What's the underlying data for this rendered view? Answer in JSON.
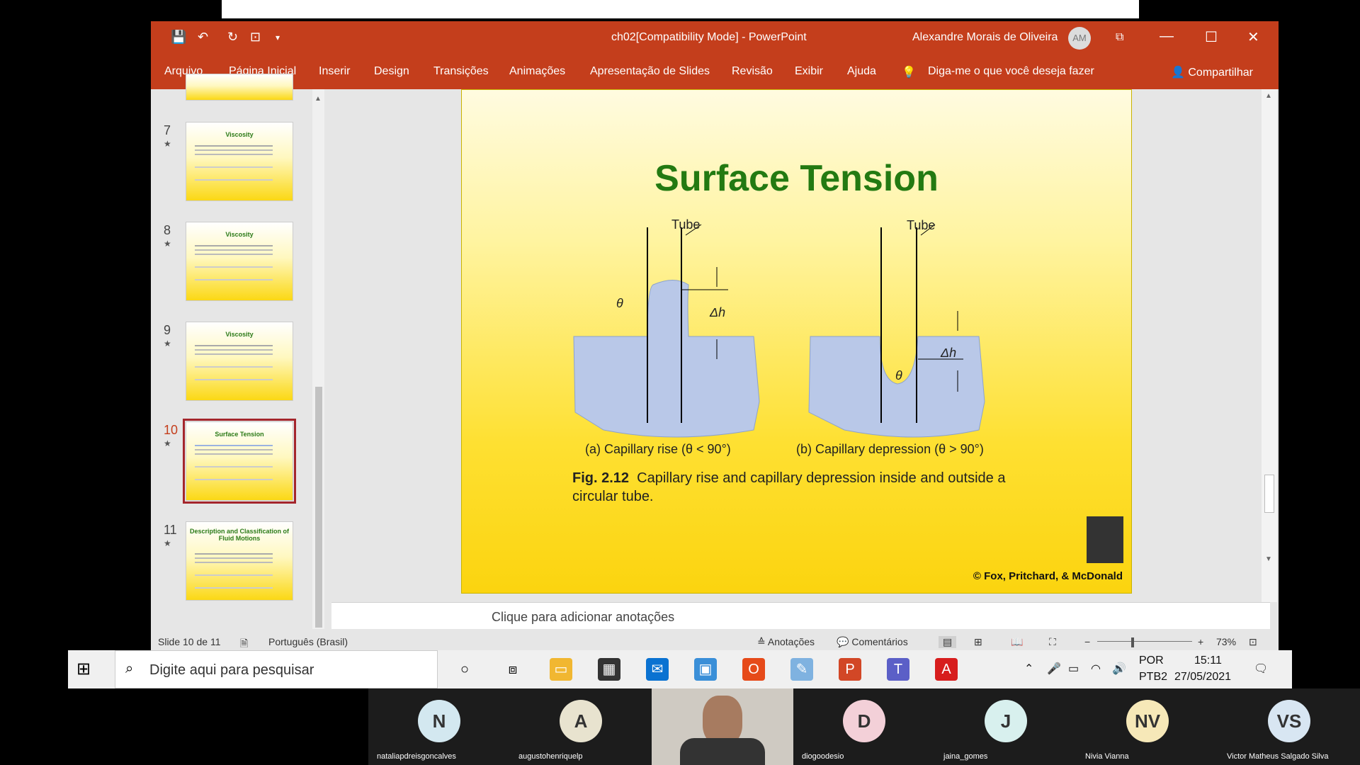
{
  "window": {
    "title": "ch02[Compatibility Mode]  -  PowerPoint",
    "user": "Alexandre Morais de Oliveira",
    "avatar": "AM"
  },
  "ribbon": {
    "tabs": [
      "Arquivo",
      "Página Inicial",
      "Inserir",
      "Design",
      "Transições",
      "Animações",
      "Apresentação de Slides",
      "Revisão",
      "Exibir",
      "Ajuda"
    ],
    "tell_me": "Diga-me o que você deseja fazer",
    "share": "Compartilhar"
  },
  "slides": [
    {
      "number": "7",
      "title": "Viscosity"
    },
    {
      "number": "8",
      "title": "Viscosity"
    },
    {
      "number": "9",
      "title": "Viscosity"
    },
    {
      "number": "10",
      "title": "Surface Tension"
    },
    {
      "number": "11",
      "title": "Description and Classification of Fluid Motions"
    }
  ],
  "slide": {
    "title": "Surface Tension",
    "tube_label": "Tube",
    "theta": "θ",
    "delta_h": "Δh",
    "caption_a": "(a) Capillary rise (θ < 90°)",
    "caption_b": "(b) Capillary depression (θ > 90°)",
    "fig_label": "Fig. 2.12",
    "fig_text": "Capillary rise and capillary depression inside and outside a circular tube.",
    "copyright": "© Fox, Pritchard, & McDonald"
  },
  "notes_placeholder": "Clique para adicionar anotações",
  "status": {
    "slide": "Slide 10 de 11",
    "language": "Português (Brasil)",
    "notes": "Anotações",
    "comments": "Comentários",
    "zoom": "73%"
  },
  "taskbar": {
    "search": "Digite aqui para pesquisar",
    "lang": "POR",
    "layout": "PTB2",
    "time": "15:11",
    "date": "27/05/2021"
  },
  "meeting": [
    {
      "initials": "N",
      "name": "nataliapdreisgoncalves"
    },
    {
      "initials": "A",
      "name": "augustohenriquelp"
    },
    {
      "initials": "",
      "name": ""
    },
    {
      "initials": "D",
      "name": "diogoodesio"
    },
    {
      "initials": "J",
      "name": "jaina_gomes"
    },
    {
      "initials": "NV",
      "name": "Nivia Vianna"
    },
    {
      "initials": "VS",
      "name": "Victor Matheus Salgado Silva"
    }
  ],
  "colors": {
    "accent": "#c43e1c",
    "slide_title": "#237a12",
    "water": "#b9c8e8"
  }
}
